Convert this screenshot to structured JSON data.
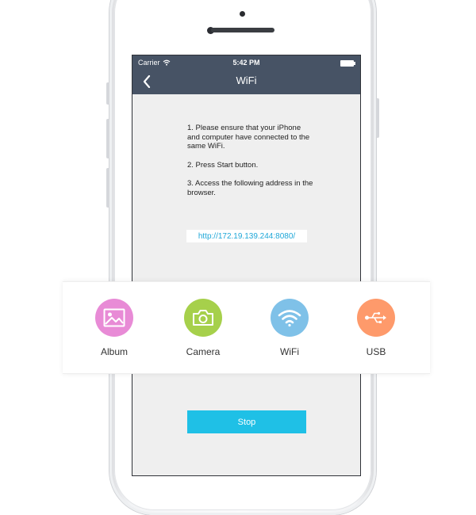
{
  "status_bar": {
    "carrier": "Carrier",
    "time": "5:42 PM"
  },
  "nav": {
    "title": "WiFi"
  },
  "instructions": [
    "1. Please ensure that your iPhone and computer have connected to the same WiFi.",
    "2. Press Start button.",
    "3. Access the following address in the browser."
  ],
  "address": "http://172.19.139.244:8080/",
  "stop_label": "Stop",
  "features": [
    {
      "label": "Album",
      "icon": "image-icon",
      "color": "#e88bd6"
    },
    {
      "label": "Camera",
      "icon": "camera-icon",
      "color": "#a6d04b"
    },
    {
      "label": "WiFi",
      "icon": "wifi-icon",
      "color": "#7fc1e8"
    },
    {
      "label": "USB",
      "icon": "usb-icon",
      "color": "#fe9a6b"
    }
  ],
  "colors": {
    "navbar": "#475365",
    "accent": "#1fc0e6",
    "screen_bg": "#efefef"
  }
}
